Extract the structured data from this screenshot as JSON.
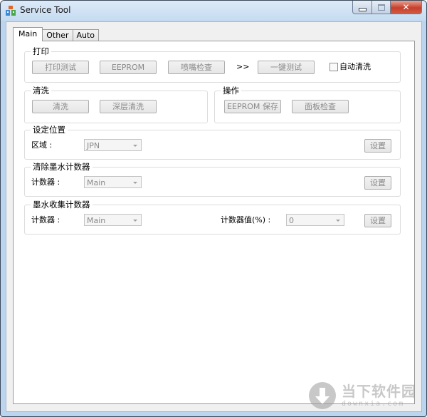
{
  "window": {
    "title": "Service Tool",
    "controls": {
      "minimize": "minimize",
      "maximize": "maximize",
      "close": "close"
    }
  },
  "tabs": [
    {
      "label": "Main",
      "active": true
    },
    {
      "label": "Other",
      "active": false
    },
    {
      "label": "Auto",
      "active": false
    }
  ],
  "print_group": {
    "title": "打印",
    "buttons": [
      "打印测试",
      "EEPROM",
      "喷嘴检查"
    ],
    "arrow": ">>",
    "one_key_test": "一键测试",
    "auto_clean": {
      "label": "自动清洗",
      "checked": false
    }
  },
  "clean_group": {
    "title": "清洗",
    "buttons": [
      "清洗",
      "深层清洗"
    ]
  },
  "operation_group": {
    "title": "操作",
    "buttons": [
      "EEPROM 保存",
      "面板检查"
    ]
  },
  "position_group": {
    "title": "设定位置",
    "region_label": "区域 :",
    "region_value": "JPN",
    "set_button": "设置"
  },
  "clear_ink_group": {
    "title": "清除墨水计数器",
    "counter_label": "计数器 :",
    "counter_value": "Main",
    "set_button": "设置"
  },
  "ink_collect_group": {
    "title": "墨水收集计数器",
    "counter_label": "计数器 :",
    "counter_value": "Main",
    "counter_value_label": "计数器值(%) :",
    "counter_percent": "0",
    "set_button": "设置"
  },
  "watermark": {
    "cn": "当下软件园",
    "en": "downxia.com"
  }
}
